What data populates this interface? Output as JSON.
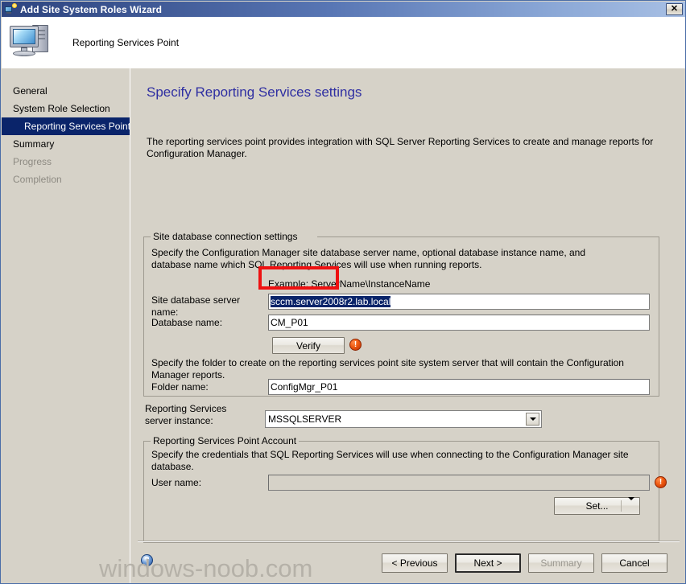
{
  "window": {
    "title": "Add Site System Roles Wizard",
    "title_icon": "wizard-computer-icon",
    "close_label": "✕",
    "banner_title": "Reporting Services Point",
    "banner_icon": "computer-icon"
  },
  "sidebar": {
    "items": [
      {
        "label": "General",
        "state": "normal",
        "sub": false
      },
      {
        "label": "System Role Selection",
        "state": "normal",
        "sub": false
      },
      {
        "label": "Reporting Services Point",
        "state": "selected",
        "sub": true
      },
      {
        "label": "Summary",
        "state": "normal",
        "sub": false
      },
      {
        "label": "Progress",
        "state": "disabled",
        "sub": false
      },
      {
        "label": "Completion",
        "state": "disabled",
        "sub": false
      }
    ]
  },
  "main": {
    "page_title": "Specify Reporting Services settings",
    "intro": "The reporting services point provides integration with SQL Server Reporting Services to create and manage reports for Configuration Manager.",
    "db_group": {
      "legend": "Site database connection settings",
      "description": "Specify the Configuration Manager site database server name, optional database instance name, and database name which SQL Reporting Services will use when running reports.",
      "example": "Example: ServerName\\InstanceName",
      "server_label": "Site database server name:",
      "server_value": "sccm.server2008r2.lab.local",
      "server_value_selected": true,
      "database_label": "Database name:",
      "database_value": "CM_P01",
      "verify_button": "Verify",
      "verify_error_icon": "error-exclamation-icon",
      "verify_error_glyph": "!",
      "folder_description": "Specify the folder to create on the reporting services point site system server that will contain the Configuration Manager reports.",
      "folder_label": "Folder name:",
      "folder_value": "ConfigMgr_P01"
    },
    "instance": {
      "label_line1": "Reporting Services",
      "label_line2": "server instance:",
      "value": "MSSQLSERVER",
      "options": [
        "MSSQLSERVER"
      ],
      "dropdown_icon": "chevron-down-icon"
    },
    "account_group": {
      "legend": "Reporting Services Point Account",
      "description": "Specify the credentials that SQL Reporting Services will use when connecting to the Configuration Manager site database.",
      "username_label": "User name:",
      "username_value": "",
      "username_placeholder": "",
      "username_error_icon": "error-exclamation-icon",
      "username_error_glyph": "!",
      "set_button": "Set...",
      "set_dropdown_icon": "chevron-down-icon"
    },
    "annotation": {
      "type": "red-rectangle-highlight",
      "target": "verify-button",
      "color": "#ee1111"
    }
  },
  "footer": {
    "help_icon": "help-question-icon",
    "help_glyph": "?",
    "buttons": [
      {
        "label": "< Previous",
        "state": "normal"
      },
      {
        "label": "Next >",
        "state": "default"
      },
      {
        "label": "Summary",
        "state": "disabled"
      },
      {
        "label": "Cancel",
        "state": "normal"
      }
    ]
  },
  "watermark": {
    "text": "windows-noob.com",
    "color": "#b5b1a8"
  }
}
